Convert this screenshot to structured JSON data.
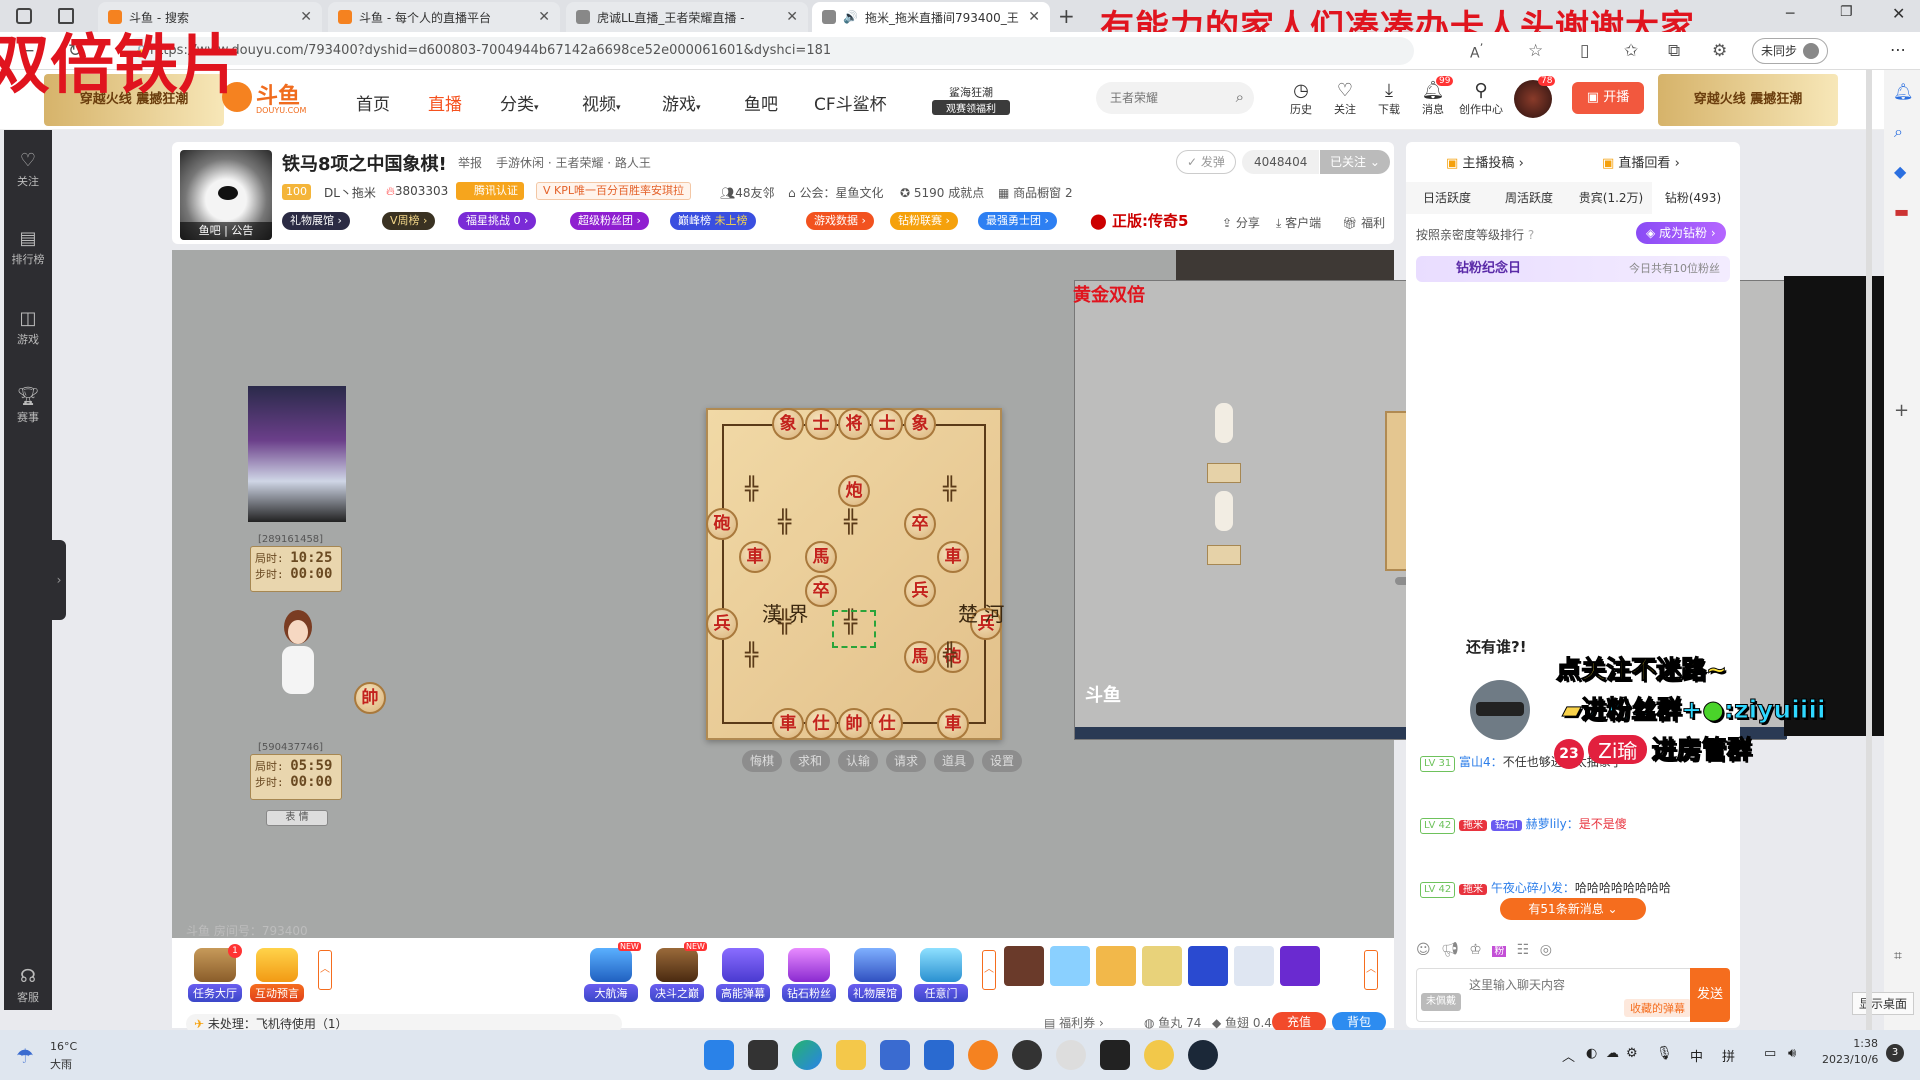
{
  "browser": {
    "tabs": [
      {
        "title": "斗鱼 - 搜索"
      },
      {
        "title": "斗鱼 - 每个人的直播平台"
      },
      {
        "title": "虎诚LL直播_王者荣耀直播 - "
      },
      {
        "title": "拖米_拖米直播间793400_王"
      }
    ],
    "new_tab": "+",
    "url": "https://www.douyu.com/793400?dyshid=d600803-7004944b67142a6698ce52e000061601&dyshci=181",
    "profile_label": "未同步",
    "red_top_banner": "有能力的家人们凑凑办卡人头谢谢大家",
    "red_left_banner": "双倍铁片"
  },
  "site": {
    "logo_text": "斗鱼",
    "logo_sub": "DOUYU.COM",
    "banner_left": "穿越火线 震撼狂潮",
    "banner_right": "穿越火线 震撼狂潮",
    "nav": [
      "首页",
      "直播",
      "分类",
      "视频",
      "游戏",
      "鱼吧",
      "CF斗鲨杯"
    ],
    "promo_title": "鲨海狂潮",
    "promo_sub": "观赛领福利",
    "search_placeholder": "王者荣耀",
    "actions": [
      "历史",
      "关注",
      "下载",
      "消息",
      "创作中心"
    ],
    "msg_badge": "99",
    "avatar_badge": "78",
    "live_btn": "开播"
  },
  "rail": [
    "关注",
    "排行榜",
    "游戏",
    "赛事",
    "客服"
  ],
  "room": {
    "title": "铁马8项之中国象棋!",
    "report": "举报",
    "category_path": "手游休闲 · 王者荣耀 · 路人王",
    "follow_btn": "发弹",
    "follow_count": "4048404",
    "followed_btn": "已关注",
    "streamer_level": "100",
    "streamer_name": "DL丶拖米",
    "heat": "3803303",
    "cert": "腾讯认证",
    "kpl_tag": "KPL唯一百分百胜率安琪拉",
    "fan_count": "48友邻",
    "guild": "公会：星鱼文化",
    "achievement": "5190 成就点",
    "shop": "商品橱窗 2",
    "avatar_caption": "鱼吧 | 公告",
    "chips": [
      "礼物展馆",
      "V周榜",
      "福星挑战",
      "超级粉丝团",
      "巅峰榜",
      "游戏数据",
      "钻粉联赛",
      "最强勇士团"
    ],
    "chip_extra_1": "0",
    "chip_extra_2": "未上榜",
    "promo_red": "正版:传奇5",
    "share": "分享",
    "client": "客户端",
    "welfare": "福利"
  },
  "game": {
    "pieces_top": [
      "象",
      "士",
      "将",
      "士",
      "象"
    ],
    "pieces": {
      "pao1": "炮",
      "pao_left": "砲",
      "zu1": "卒",
      "ju1": "車",
      "ma1": "馬",
      "ju2": "車",
      "zu2": "卒",
      "bing_r": "兵",
      "bing1": "兵",
      "bing2": "兵",
      "ma2": "馬",
      "pao2": "砲",
      "bottom": [
        "車",
        "仕",
        "帥",
        "仕",
        "車"
      ]
    },
    "river_left": "漢 界",
    "river_right": "楚 河",
    "player_top_id": "[289161458]",
    "player_top_time_label1": "局时",
    "player_top_time1": "10:25",
    "player_top_time_label2": "步时",
    "player_top_time2": "00:00",
    "player_bottom_id": "[590437746]",
    "player_bottom_time1": "05:59",
    "player_bottom_time2": "00:00",
    "side_piece": "帥",
    "bottom_btn": "表 情",
    "controls": [
      "悔棋",
      "求和",
      "认输",
      "请求",
      "道具",
      "设置"
    ],
    "watermark": "斗鱼 房间号：793400"
  },
  "overlay": {
    "pip_title": "黄金双倍",
    "sticker_question": "还有谁?!",
    "caption1": "点关注不迷路~",
    "caption2": "进粉丝群+",
    "caption2_id": "ziyuiiii",
    "caption3_badge": "23",
    "caption3_name": "Zi瑜",
    "caption3_tail": "进房管群"
  },
  "right": {
    "top_links": [
      "主播投稿",
      "直播回看"
    ],
    "tabs": [
      "日活跃度",
      "周活跃度",
      "贵宾(1.2万)",
      "钻粉(493)"
    ],
    "rank_text": "按照亲密度等级排行",
    "become_diamond": "成为钻粉",
    "diamond_day": "钻粉纪念日",
    "diamond_day_sub": "今日共有10位粉丝",
    "chat": [
      {
        "lv": "LV 31",
        "user": "富山4：",
        "text": "不任也够进，太抽象了"
      },
      {
        "lv": "LV 42",
        "badge": "拖米",
        "badge2": "钻石Ⅰ",
        "user": "赫萝lily：",
        "text": "是不是傻"
      },
      {
        "lv": "LV 42",
        "badge": "拖米",
        "user": "午夜心碎小发：",
        "text": "哈哈哈哈哈哈哈哈"
      }
    ],
    "new_msgs": "有51条新消息",
    "input_placeholder": "这里输入聊天内容",
    "barrage_btn": "收藏的弹幕",
    "send": "发送",
    "unlogged": "未佩戴"
  },
  "bottom": {
    "left_items": [
      "任务大厅",
      "互动预言"
    ],
    "task_badge": "1",
    "pending": "未处理：飞机待使用（1）",
    "mid_items": [
      "大航海",
      "决斗之巅",
      "高能弹幕",
      "钻石粉丝",
      "礼物展馆",
      "任意门"
    ],
    "new_tag": "NEW",
    "welfare": "福利券",
    "fishball": "鱼丸 74",
    "fishfin": "鱼翅 0.4",
    "recharge": "充值",
    "backpack": "背包"
  },
  "taskbar": {
    "weather_temp": "16°C",
    "weather_desc": "大雨",
    "ime1": "中",
    "ime2": "拼",
    "time": "1:38",
    "date": "2023/10/6",
    "notif": "3",
    "show_desktop": "显示桌面"
  }
}
